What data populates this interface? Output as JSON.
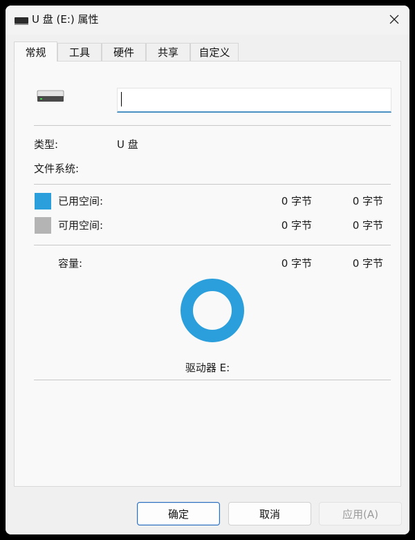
{
  "window": {
    "title": "U 盘 (E:) 属性"
  },
  "tabs": [
    {
      "label": "常规",
      "active": true
    },
    {
      "label": "工具",
      "active": false
    },
    {
      "label": "硬件",
      "active": false
    },
    {
      "label": "共享",
      "active": false
    },
    {
      "label": "自定义",
      "active": false
    }
  ],
  "general": {
    "volume_label_value": "",
    "type_label": "类型:",
    "type_value": "U 盘",
    "filesystem_label": "文件系统:",
    "filesystem_value": "",
    "used": {
      "label": "已用空间:",
      "bytes": "0 字节",
      "size": "0 字节",
      "color": "#2b9fdb"
    },
    "free": {
      "label": "可用空间:",
      "bytes": "0 字节",
      "size": "0 字节",
      "color": "#b4b4b4"
    },
    "capacity": {
      "label": "容量:",
      "bytes": "0 字节",
      "size": "0 字节"
    },
    "drive_label": "驱动器 E:",
    "pie_color": "#2b9fdb"
  },
  "buttons": {
    "ok": "确定",
    "cancel": "取消",
    "apply": "应用(A)"
  },
  "icons": {
    "title": "usb-drive-icon",
    "close": "close-icon",
    "drive": "drive-icon"
  }
}
